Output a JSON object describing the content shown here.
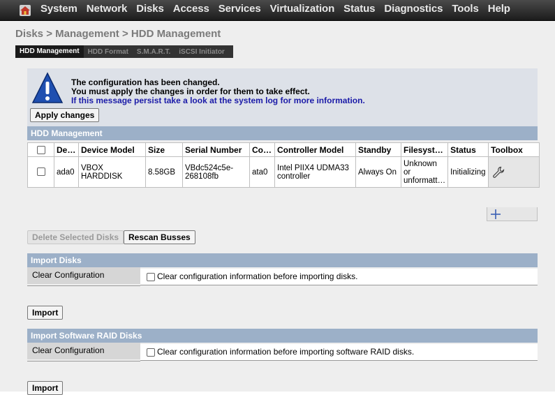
{
  "nav": {
    "items": [
      "System",
      "Network",
      "Disks",
      "Access",
      "Services",
      "Virtualization",
      "Status",
      "Diagnostics",
      "Tools",
      "Help"
    ]
  },
  "breadcrumb": "Disks > Management > HDD Management",
  "tabs": [
    "HDD Management",
    "HDD Format",
    "S.M.A.R.T.",
    "iSCSI Initiator"
  ],
  "notice": {
    "line1": "The configuration has been changed.",
    "line2": "You must apply the changes in order for them to take effect.",
    "line3": "If this message persist take a look at the system log for more information.",
    "apply_label": "Apply changes"
  },
  "hdd": {
    "title": "HDD Management",
    "columns": [
      "",
      "De…",
      "Device Model",
      "Size",
      "Serial Number",
      "Co…",
      "Controller Model",
      "Standby",
      "Filesyst…",
      "Status",
      "Toolbox"
    ],
    "rows": [
      {
        "device": "ada0",
        "model": "VBOX HARDDISK",
        "size": "8.58GB",
        "serial": "VBdc524c5e-268108fb",
        "controller": "ata0",
        "controller_model": "Intel PIIX4 UDMA33 controller",
        "standby": "Always On",
        "filesystem": "Unknown or unformatt…",
        "status": "Initializing"
      }
    ],
    "delete_label": "Delete Selected Disks",
    "rescan_label": "Rescan Busses"
  },
  "import_disks": {
    "title": "Import Disks",
    "label": "Clear Configuration",
    "checkbox_text": "Clear configuration information before importing disks.",
    "button": "Import"
  },
  "import_raid": {
    "title": "Import Software RAID Disks",
    "label": "Clear Configuration",
    "checkbox_text": "Clear configuration information before importing software RAID disks.",
    "button": "Import"
  },
  "colors": {
    "section_header": "#9cb0c8",
    "notice_bg": "#dde1e8",
    "link_blue": "#1b1ba8",
    "icon_blue": "#1f4fb0"
  }
}
